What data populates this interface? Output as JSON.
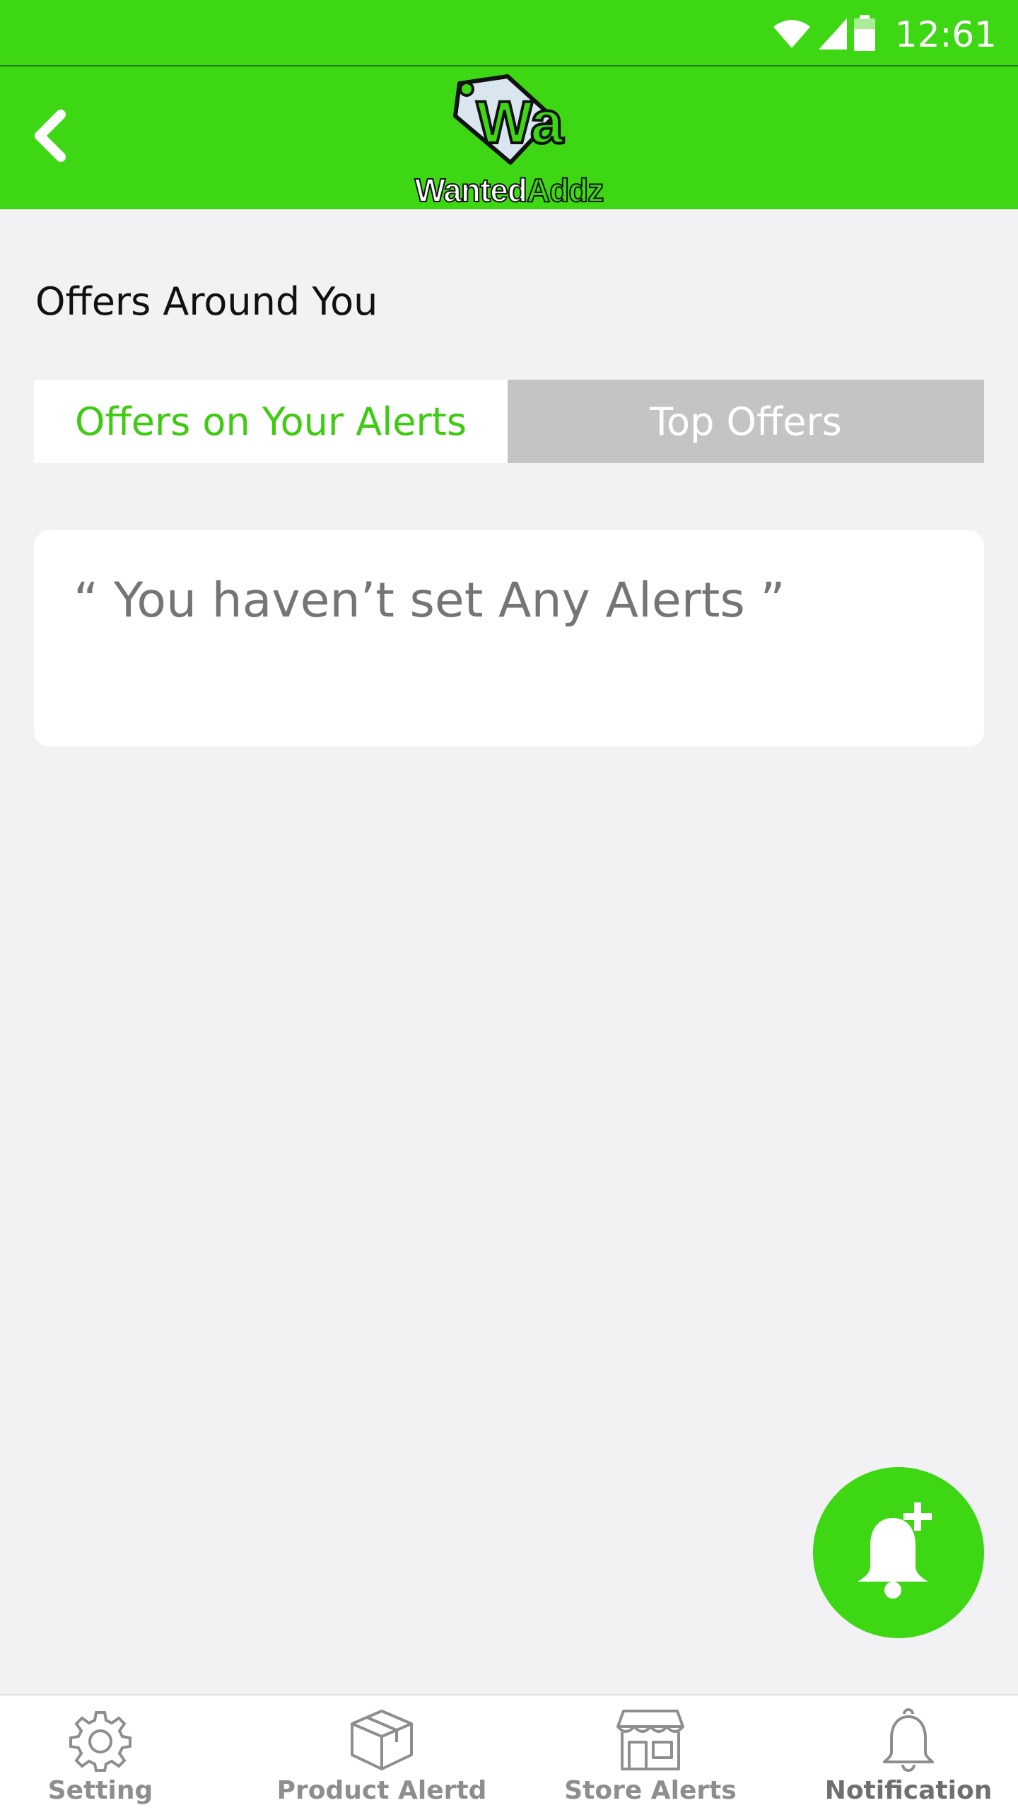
{
  "status_bar": {
    "time": "12:61",
    "icons": [
      "wifi-icon",
      "signal-icon",
      "battery-icon"
    ]
  },
  "header": {
    "back_icon": "chevron-left-icon",
    "logo": {
      "mark_text": "Wa",
      "word_part1": "Wanted",
      "word_part2": "Addz"
    }
  },
  "main": {
    "section_title": "Offers Around You",
    "tabs": [
      {
        "label": "Offers on Your Alerts",
        "active": true
      },
      {
        "label": "Top Offers",
        "active": false
      }
    ],
    "empty_message": "“ You haven’t set Any Alerts ”"
  },
  "fab": {
    "icon": "bell-plus-icon"
  },
  "bottom_nav": {
    "items": [
      {
        "label": "Setting",
        "icon": "gear-icon"
      },
      {
        "label": "Product Alertd",
        "icon": "box-icon"
      },
      {
        "label": "Store Alerts",
        "icon": "store-icon"
      },
      {
        "label": "Notification",
        "icon": "bell-icon"
      }
    ]
  },
  "colors": {
    "brand_green": "#3ed714",
    "active_tab_text": "#3ecb12",
    "inactive_tab_bg": "#c4c4c6",
    "background": "#f2f2f4",
    "muted_text": "#757575"
  }
}
